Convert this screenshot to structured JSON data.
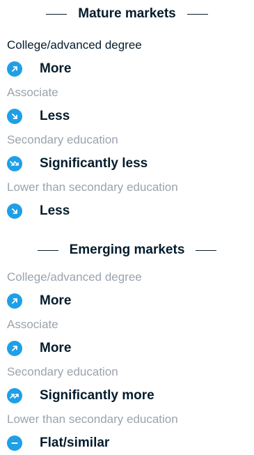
{
  "mature": {
    "title": "Mature markets",
    "items": [
      {
        "level": "College/advanced degree",
        "trend": "More",
        "icon": "arrow-up-right-icon"
      },
      {
        "level": "Associate",
        "trend": "Less",
        "icon": "arrow-down-right-icon"
      },
      {
        "level": "Secondary education",
        "trend": "Significantly less",
        "icon": "double-arrow-down-right-icon"
      },
      {
        "level": "Lower than secondary education",
        "trend": "Less",
        "icon": "arrow-down-right-icon"
      }
    ]
  },
  "emerging": {
    "title": "Emerging markets",
    "items": [
      {
        "level": "College/advanced degree",
        "trend": "More",
        "icon": "arrow-up-right-icon"
      },
      {
        "level": "Associate",
        "trend": "More",
        "icon": "arrow-up-right-icon"
      },
      {
        "level": "Secondary education",
        "trend": "Significantly more",
        "icon": "double-arrow-up-right-icon"
      },
      {
        "level": "Lower than secondary education",
        "trend": "Flat/similar",
        "icon": "dash-icon"
      }
    ]
  },
  "colors": {
    "accent": "#1f9fe6",
    "text": "#051c2c",
    "muted": "#9aa3ad"
  }
}
